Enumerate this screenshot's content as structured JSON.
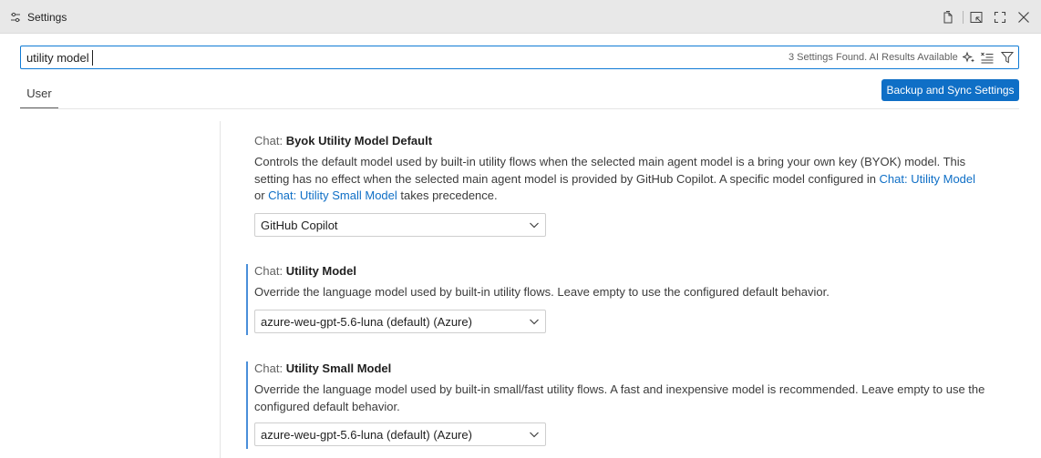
{
  "window": {
    "title": "Settings"
  },
  "search": {
    "value": "utility model",
    "result_count": "3 Settings Found. AI Results Available"
  },
  "tabs": [
    {
      "label": "User"
    }
  ],
  "sync_button": {
    "label": "Backup and Sync Settings"
  },
  "settings": [
    {
      "category": "Chat: ",
      "name": "Byok Utility Model Default",
      "desc_part1": "Controls the default model used by built-in utility flows when the selected main agent model is a bring your own key (BYOK) model. This setting has no effect when the selected main agent model is provided by GitHub Copilot. A specific model configured in ",
      "link1": "Chat: Utility Model",
      "desc_part2": " or ",
      "link2": "Chat: Utility Small Model",
      "desc_part3": " takes precedence.",
      "value": "GitHub Copilot",
      "modified": false
    },
    {
      "category": "Chat: ",
      "name": "Utility Model",
      "description": "Override the language model used by built-in utility flows. Leave empty to use the configured default behavior.",
      "value": "azure-weu-gpt-5.6-luna (default) (Azure)",
      "modified": true
    },
    {
      "category": "Chat: ",
      "name": "Utility Small Model",
      "description": "Override the language model used by built-in small/fast utility flows. A fast and inexpensive model is recommended. Leave empty to use the configured default behavior.",
      "value": "azure-weu-gpt-5.6-luna (default) (Azure)",
      "modified": true
    }
  ],
  "colors": {
    "accent": "#0f6fc6",
    "modified_bar": "#4a8fd9",
    "focus_border": "#0f7bd5"
  }
}
